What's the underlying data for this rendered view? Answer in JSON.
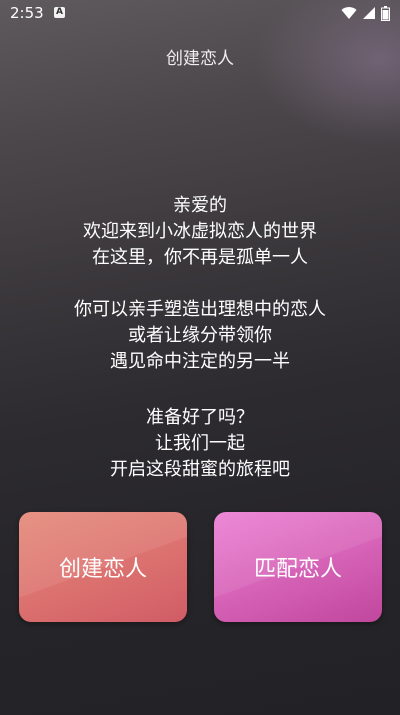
{
  "status_bar": {
    "time": "2:53",
    "notification_badge": "A"
  },
  "header": {
    "title": "创建恋人"
  },
  "message": {
    "paragraph1": [
      "亲爱的",
      "欢迎来到小冰虚拟恋人的世界",
      "在这里，你不再是孤单一人"
    ],
    "paragraph2": [
      "你可以亲手塑造出理想中的恋人",
      "或者让缘分带领你",
      "遇见命中注定的另一半"
    ],
    "paragraph3": [
      "准备好了吗？",
      "让我们一起",
      "开启这段甜蜜的旅程吧"
    ]
  },
  "actions": {
    "create_label": "创建恋人",
    "match_label": "匹配恋人"
  },
  "colors": {
    "create_button": "#de7671",
    "match_button": "#d764b8"
  }
}
